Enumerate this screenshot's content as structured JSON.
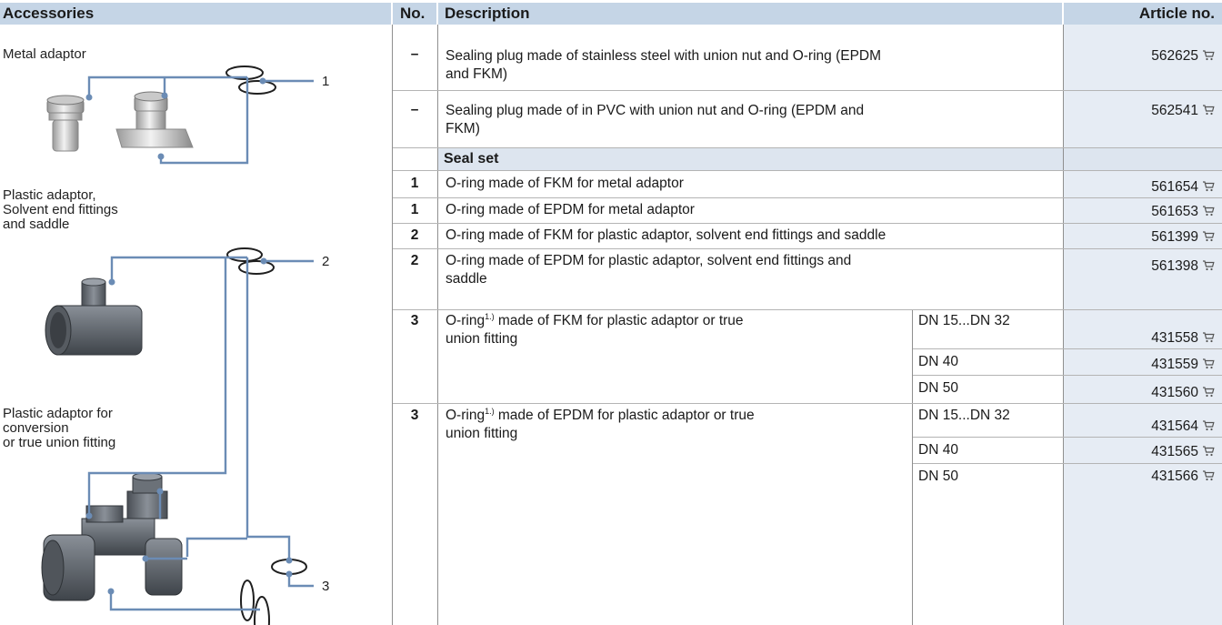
{
  "header": {
    "accessories": "Accessories",
    "no": "No.",
    "description": "Description",
    "article_no": "Article no."
  },
  "images": {
    "metal_adaptor": "Metal adaptor",
    "plastic_adaptor_1": "Plastic adaptor,",
    "plastic_adaptor_2": "Solvent end fittings",
    "plastic_adaptor_3": "and saddle",
    "conversion_1": "Plastic adaptor for",
    "conversion_2": "conversion",
    "conversion_3": "or true union fitting",
    "callout_1": "1",
    "callout_2": "2",
    "callout_3": "3"
  },
  "rows": [
    {
      "no": "–",
      "desc_1": "Sealing plug made of stainless steel with union nut and O-ring (EPDM",
      "desc_2": "and FKM)",
      "article": "562625"
    },
    {
      "no": "–",
      "desc_1": "Sealing plug made of in PVC with union nut and O-ring (EPDM and",
      "desc_2": "FKM)",
      "article": "562541"
    }
  ],
  "seal_set": {
    "title": "Seal set",
    "rows": [
      {
        "no": "1",
        "desc": "O-ring made of FKM for metal adaptor",
        "article": "561654"
      },
      {
        "no": "1",
        "desc": "O-ring made of EPDM for metal adaptor",
        "article": "561653"
      },
      {
        "no": "2",
        "desc": "O-ring made of FKM for plastic adaptor, solvent end fittings and saddle",
        "article": "561399"
      },
      {
        "no": "2",
        "desc_1": "O-ring made of EPDM for plastic adaptor, solvent end fittings and",
        "desc_2": "saddle",
        "article": "561398"
      }
    ],
    "groups": [
      {
        "no": "3",
        "desc_a": "O-ring",
        "footnote": "1.)",
        "desc_b": " made of FKM for plastic adaptor or true",
        "desc_2": "union fitting",
        "sizes": [
          {
            "dn": "DN 15...DN 32",
            "article": "431558"
          },
          {
            "dn": "DN 40",
            "article": "431559"
          },
          {
            "dn": "DN 50",
            "article": "431560"
          }
        ]
      },
      {
        "no": "3",
        "desc_a": "O-ring",
        "footnote": "1.)",
        "desc_b": " made of EPDM for plastic adaptor or true",
        "desc_2": "union fitting",
        "sizes": [
          {
            "dn": "DN 15...DN 32",
            "article": "431564"
          },
          {
            "dn": "DN 40",
            "article": "431565"
          },
          {
            "dn": "DN 50",
            "article": "431566"
          }
        ]
      }
    ]
  },
  "colors": {
    "header_bg": "#c5d5e6",
    "article_bg": "#e6ecf4",
    "leader_line": "#6b8cb5"
  },
  "icons": {
    "cart": "shopping-cart-icon"
  }
}
